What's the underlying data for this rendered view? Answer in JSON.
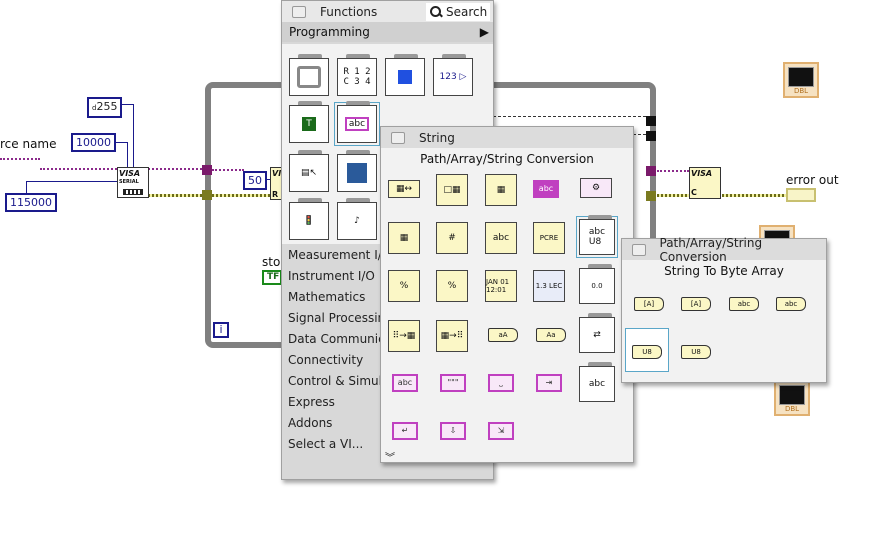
{
  "diagram": {
    "resource_name_label": "rce name",
    "const_255": "255",
    "const_255_prefix": "d",
    "const_10000": "10000",
    "const_115000": "115000",
    "const_50": "50",
    "visa_serial_label": "VISA",
    "visa_serial_sub": "SERIAL",
    "visa_read_label": "VI",
    "visa_read_sub": "R",
    "visa_close_label": "VISA",
    "visa_close_sub": "C",
    "stop_label": "stop",
    "stop_const": "TF",
    "loop_iteration": "i",
    "error_out_label": "error out",
    "graph_type": "DBL",
    "colors": {
      "refnum_wire": "#8b2a8b",
      "error_wire": "#6b6b1a",
      "numeric": "#1a1a8c",
      "loop": "#808080"
    }
  },
  "functions_palette": {
    "title": "Functions",
    "search_label": "Search",
    "section": "Programming",
    "icons": [
      "structures",
      "array",
      "cluster",
      "numeric",
      "boolean",
      "string",
      "comparison",
      "timing",
      "dialog-ui",
      "file-io",
      "waveform",
      "graphics-sound"
    ],
    "categories": [
      "Measurement I/O",
      "Instrument I/O",
      "Mathematics",
      "Signal Processing",
      "Data Communica",
      "Connectivity",
      "Control & Simula",
      "Express",
      "Addons",
      "Select a VI..."
    ]
  },
  "string_palette": {
    "title": "String",
    "hover_label": "Path/Array/String Conversion",
    "icon_texts": {
      "abc": "abc",
      "quote": "\"\"\"",
      "aA": "aA",
      "Aa": "Aa",
      "num": "0.0",
      "pcre": "PCRE",
      "date": "JAN 01 12:01",
      "lec": "1.3 LEC"
    }
  },
  "conversion_palette": {
    "title": "Path/Array/String Conversion",
    "hover_label": "String To Byte Array",
    "icons": [
      "array-to-path",
      "path-to-array",
      "path-to-string",
      "string-to-path",
      "string-to-byte-array",
      "byte-array-to-string"
    ],
    "icon_texts": [
      "[A]",
      "[A]",
      "abc",
      "abc",
      "U8",
      "U8"
    ]
  }
}
